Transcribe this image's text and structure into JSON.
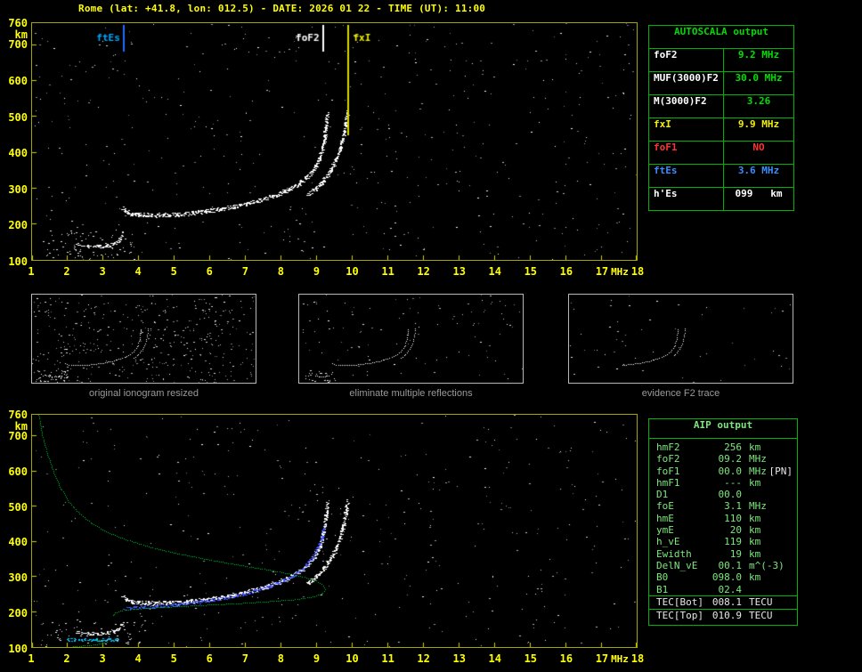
{
  "title": "Rome (lat: +41.8, lon: 012.5) - DATE: 2026 01 22 - TIME (UT): 11:00",
  "colors": {
    "bg": "#000000",
    "title": "#ffff00",
    "axis": "#ffff00",
    "plot_border": "#a6a600",
    "tbl_green": "#00b400",
    "as_green": "#00dd00",
    "caption": "#9a9a9a",
    "aip_text": "#7ce87c",
    "aip_white": "#e8e8e8",
    "thumb_border": "#b8b8b8"
  },
  "axes": {
    "x_ticks": [
      "1",
      "2",
      "3",
      "4",
      "5",
      "6",
      "7",
      "8",
      "9",
      "10",
      "11",
      "12",
      "13",
      "14",
      "15",
      "16",
      "17",
      "18"
    ],
    "x_unit": "MHz",
    "y_ticks": [
      "760",
      "700",
      "600",
      "500",
      "400",
      "300",
      "200",
      "100"
    ],
    "y_unit": "km"
  },
  "autoscala": {
    "title": "AUTOSCALA output",
    "rows": [
      {
        "label": "foF2",
        "value": "9.2 MHz",
        "color": "#ffffff",
        "value_color": "#00e000"
      },
      {
        "label": "MUF(3000)F2",
        "value": "30.0 MHz",
        "color": "#ffffff",
        "value_color": "#00e000"
      },
      {
        "label": "M(3000)F2",
        "value": "3.26",
        "color": "#ffffff",
        "value_color": "#00e000"
      },
      {
        "label": "fxI",
        "value": "9.9 MHz",
        "color": "#f0f000",
        "value_color": "#f0f000"
      },
      {
        "label": "foF1",
        "value": "NO",
        "color": "#ff3232",
        "value_color": "#ff3232"
      },
      {
        "label": "ftEs",
        "value": "3.6 MHz",
        "color": "#3b8eff",
        "value_color": "#3b8eff"
      },
      {
        "label": "h'Es",
        "value": "099   km",
        "color": "#ffffff",
        "value_color": "#ffffff"
      }
    ]
  },
  "thumbnails": [
    {
      "caption": "original ionogram resized"
    },
    {
      "caption": "eliminate multiple reflections"
    },
    {
      "caption": "evidence F2 trace"
    }
  ],
  "aip": {
    "title": "AIP output",
    "rows": [
      {
        "name": "hmF2",
        "value": "256",
        "unit": "km"
      },
      {
        "name": "foF2",
        "value": "09.2",
        "unit": "MHz"
      },
      {
        "name": "foF1",
        "value": "00.0",
        "unit": "MHz",
        "note": "[PN]"
      },
      {
        "name": "hmF1",
        "value": "---",
        "unit": "km"
      },
      {
        "name": "D1",
        "value": "00.0",
        "unit": ""
      },
      {
        "name": "foE",
        "value": "3.1",
        "unit": "MHz"
      },
      {
        "name": "hmE",
        "value": "110",
        "unit": "km"
      },
      {
        "name": "ymE",
        "value": "20",
        "unit": "km"
      },
      {
        "name": "h_vE",
        "value": "119",
        "unit": "km"
      },
      {
        "name": "Ewidth",
        "value": "19",
        "unit": "km"
      },
      {
        "name": "DelN_vE",
        "value": "00.1",
        "unit": "m^(-3)"
      },
      {
        "name": "B0",
        "value": "098.0",
        "unit": "km"
      },
      {
        "name": "B1",
        "value": "02.4",
        "unit": ""
      }
    ],
    "tec_rows": [
      {
        "name": "TEC[Bot]",
        "value": "008.1",
        "unit": "TECU"
      },
      {
        "name": "TEC[Top]",
        "value": "010.9",
        "unit": "TECU"
      }
    ]
  },
  "chart_data": [
    {
      "name": "main_ionogram",
      "type": "scatter",
      "xlabel": "MHz",
      "ylabel": "km",
      "xlim": [
        1,
        18
      ],
      "ylim": [
        100,
        760
      ],
      "axis_ticks": true,
      "noise": {
        "seed": 11,
        "count": 520
      },
      "clusters": [
        {
          "f": [
            1.25,
            3.9
          ],
          "h": [
            100,
            180
          ],
          "count": 80,
          "color": "#e8e8e8"
        }
      ],
      "series": [
        {
          "name": "F2 ordinary trace",
          "color": "#ffffff",
          "size": 3,
          "points": [
            [
              3.55,
              243
            ],
            [
              3.65,
              233
            ],
            [
              3.8,
              228
            ],
            [
              4.0,
              226
            ],
            [
              4.3,
              224
            ],
            [
              4.7,
              224
            ],
            [
              5.1,
              226
            ],
            [
              5.5,
              230
            ],
            [
              5.9,
              235
            ],
            [
              6.3,
              241
            ],
            [
              6.7,
              248
            ],
            [
              7.1,
              257
            ],
            [
              7.5,
              268
            ],
            [
              7.9,
              281
            ],
            [
              8.2,
              295
            ],
            [
              8.5,
              312
            ],
            [
              8.75,
              332
            ],
            [
              8.95,
              356
            ],
            [
              9.08,
              382
            ],
            [
              9.17,
              412
            ],
            [
              9.23,
              444
            ],
            [
              9.27,
              478
            ],
            [
              9.3,
              505
            ]
          ]
        },
        {
          "name": "F2 extraordinary trace",
          "color": "#ffffff",
          "size": 3,
          "points": [
            [
              8.75,
              280
            ],
            [
              9.0,
              300
            ],
            [
              9.2,
              322
            ],
            [
              9.4,
              350
            ],
            [
              9.55,
              380
            ],
            [
              9.67,
              412
            ],
            [
              9.76,
              446
            ],
            [
              9.82,
              480
            ],
            [
              9.87,
              512
            ]
          ]
        },
        {
          "name": "sporadic E trace",
          "color": "#ffffff",
          "size": 2,
          "points": [
            [
              2.25,
              141
            ],
            [
              2.55,
              138
            ],
            [
              2.85,
              137
            ],
            [
              3.1,
              139
            ],
            [
              3.3,
              144
            ],
            [
              3.45,
              154
            ],
            [
              3.55,
              168
            ]
          ]
        }
      ],
      "markers": [
        {
          "label": "ftEs",
          "freq": 3.6,
          "line_color": "#1f6fff",
          "label_color": "#00a8ff",
          "side": "left",
          "len": 30
        },
        {
          "label": "foF2",
          "freq": 9.2,
          "line_color": "#ffffff",
          "label_color": "#ffffff",
          "side": "left",
          "len": 30
        },
        {
          "label": "fxI",
          "freq": 9.9,
          "line_color": "#d8d800",
          "label_color": "#f0f000",
          "side": "right",
          "len": 124
        }
      ]
    },
    {
      "name": "thumb_original_resized",
      "type": "scatter",
      "xlim": [
        1,
        18
      ],
      "ylim": [
        90,
        780
      ],
      "noise": {
        "seed": 21,
        "count": 430
      },
      "clusters": [
        {
          "f": [
            1.3,
            3.9
          ],
          "h": [
            95,
            185
          ],
          "count": 40,
          "color": "#e8e8e8"
        }
      ],
      "series_refs": [
        {
          "ref": 0
        },
        {
          "ref": 1
        },
        {
          "ref": 2
        }
      ],
      "trace_size": 1
    },
    {
      "name": "thumb_multiple_reflections_removed",
      "type": "scatter",
      "xlim": [
        1,
        18
      ],
      "ylim": [
        90,
        780
      ],
      "noise": {
        "seed": 22,
        "count": 110
      },
      "clusters": [
        {
          "f": [
            1.4,
            3.8
          ],
          "h": [
            95,
            175
          ],
          "count": 22,
          "color": "#e8e8e8"
        }
      ],
      "series_refs": [
        {
          "ref": 0
        },
        {
          "ref": 1
        },
        {
          "ref": 2
        }
      ],
      "trace_size": 1
    },
    {
      "name": "thumb_evidence_f2_trace",
      "type": "scatter",
      "xlim": [
        1,
        18
      ],
      "ylim": [
        90,
        780
      ],
      "noise": {
        "seed": 23,
        "count": 55
      },
      "series_refs": [
        {
          "ref": 0,
          "fmin": 4.8
        },
        {
          "ref": 1,
          "fmin": 9.0
        }
      ],
      "trace_size": 1
    },
    {
      "name": "restored_trace_and_profile",
      "type": "scatter",
      "xlabel": "MHz",
      "ylabel": "km",
      "xlim": [
        1,
        18
      ],
      "ylim": [
        100,
        760
      ],
      "axis_ticks": true,
      "noise": {
        "seed": 31,
        "count": 430
      },
      "clusters": [
        {
          "f": [
            1.25,
            4.2
          ],
          "h": [
            100,
            170
          ],
          "count": 55,
          "color": "#e8e8e8"
        }
      ],
      "series_refs": [
        {
          "ref": 0
        },
        {
          "ref": 1
        },
        {
          "ref": 2
        }
      ],
      "series": [
        {
          "name": "restored F2 trace",
          "color": "#4455ff",
          "size": 2,
          "points": [
            [
              3.6,
              208
            ],
            [
              3.85,
              211
            ],
            [
              4.15,
              213
            ],
            [
              4.5,
              215
            ],
            [
              4.9,
              218
            ],
            [
              5.3,
              222
            ],
            [
              5.7,
              227
            ],
            [
              6.1,
              233
            ],
            [
              6.5,
              240
            ],
            [
              6.9,
              249
            ],
            [
              7.3,
              260
            ],
            [
              7.7,
              273
            ],
            [
              8.1,
              289
            ],
            [
              8.45,
              308
            ],
            [
              8.7,
              330
            ],
            [
              8.9,
              355
            ],
            [
              9.05,
              383
            ],
            [
              9.15,
              412
            ],
            [
              9.21,
              440
            ]
          ]
        },
        {
          "name": "electron density profile",
          "color": "#00cc33",
          "size": 1,
          "points": [
            [
              1.2,
              758
            ],
            [
              1.3,
              700
            ],
            [
              1.45,
              645
            ],
            [
              1.62,
              595
            ],
            [
              1.82,
              550
            ],
            [
              2.05,
              512
            ],
            [
              2.35,
              478
            ],
            [
              2.7,
              450
            ],
            [
              3.15,
              425
            ],
            [
              3.7,
              403
            ],
            [
              4.35,
              383
            ],
            [
              5.1,
              365
            ],
            [
              5.95,
              348
            ],
            [
              6.9,
              331
            ],
            [
              7.8,
              316
            ],
            [
              8.5,
              302
            ],
            [
              9.0,
              288
            ],
            [
              9.2,
              274
            ],
            [
              9.25,
              262
            ],
            [
              9.15,
              250
            ],
            [
              8.85,
              241
            ],
            [
              8.35,
              234
            ],
            [
              7.7,
              229
            ],
            [
              6.95,
              224
            ],
            [
              6.15,
              220
            ],
            [
              5.35,
              216
            ],
            [
              4.6,
              212
            ],
            [
              3.95,
              208
            ],
            [
              3.55,
              203
            ],
            [
              3.35,
              197
            ],
            [
              3.28,
              190
            ]
          ]
        },
        {
          "name": "E layer profile",
          "color": "#00cc33",
          "size": 1,
          "points": [
            [
              2.1,
              100
            ],
            [
              2.5,
              103
            ],
            [
              2.85,
              107
            ],
            [
              3.05,
              111
            ],
            [
              3.12,
              115
            ],
            [
              3.0,
              118
            ],
            [
              2.85,
              120
            ]
          ]
        },
        {
          "name": "restored Es trace",
          "color": "#00c8ff",
          "size": 2,
          "points": [
            [
              2.0,
              121
            ],
            [
              2.4,
              120
            ],
            [
              2.8,
              119
            ],
            [
              3.15,
              119
            ],
            [
              3.4,
              120
            ]
          ]
        }
      ]
    }
  ]
}
